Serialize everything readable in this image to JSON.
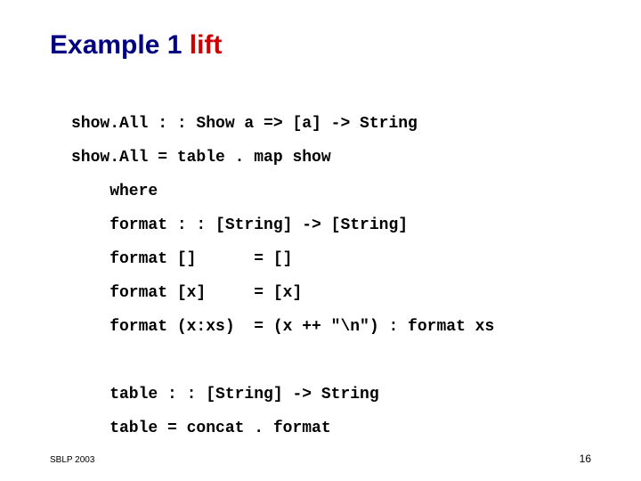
{
  "title": {
    "part1": "Example 1 ",
    "part2": "lift"
  },
  "code": {
    "l1": "show.All : : Show a => [a] -> String",
    "l2": "show.All = table . map show",
    "l3": "    where",
    "l4": "    format : : [String] -> [String]",
    "l5": "    format []      = []",
    "l6": "    format [x]     = [x]",
    "l7": "    format (x:xs)  = (x ++ \"\\n\") : format xs",
    "l8": "",
    "l9": "    table : : [String] -> String",
    "l10": "    table = concat . format"
  },
  "footer": {
    "left": "SBLP 2003",
    "right": "16"
  }
}
